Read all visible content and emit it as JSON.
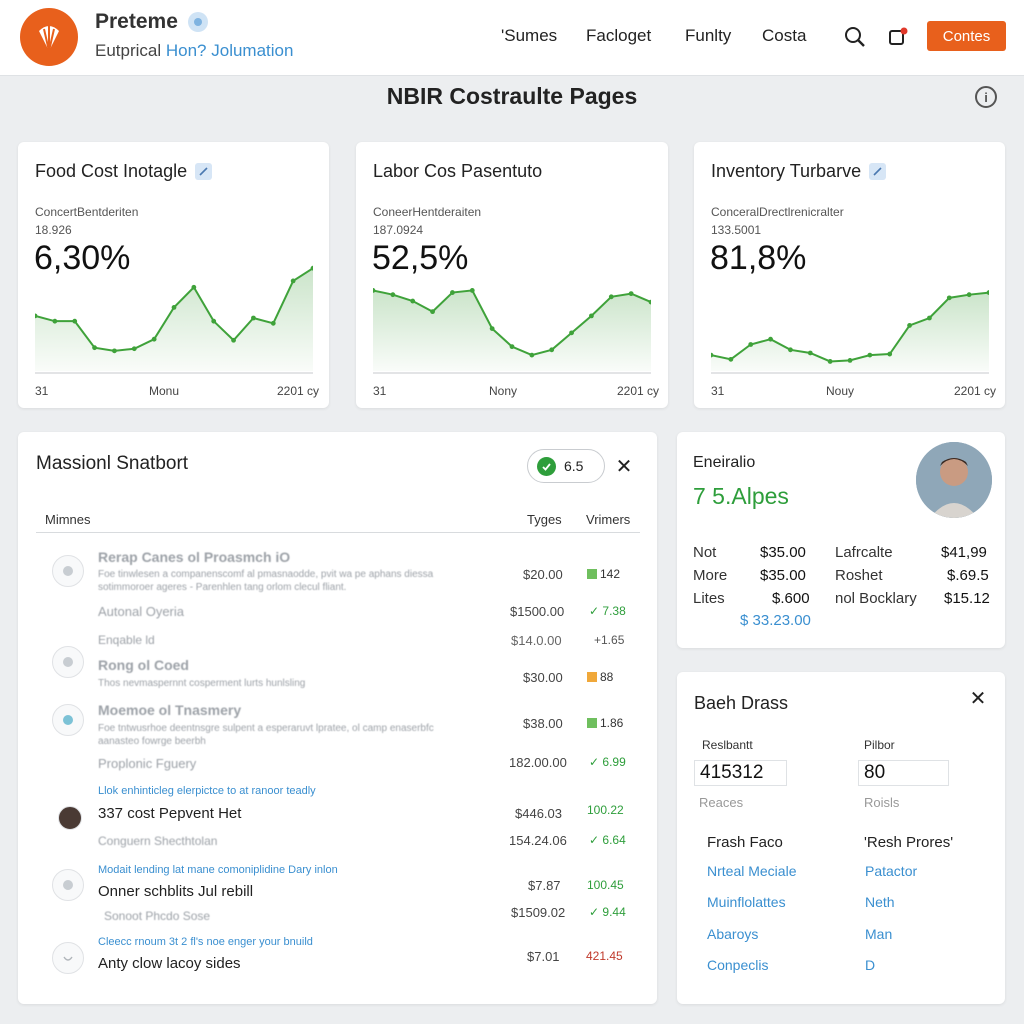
{
  "header": {
    "brand_name": "Preteme",
    "subtitle_plain": "Eutprical ",
    "subtitle_accent": "Hon? Jolumation",
    "nav": [
      "'Sumes",
      "Facloget",
      "Funlty",
      "Costa"
    ],
    "contact_label": "Contes",
    "icons": [
      "search-icon",
      "notification-icon"
    ]
  },
  "page": {
    "title": "NBIR Costraulte Pages",
    "info_icon": "i"
  },
  "kpis": [
    {
      "title": "Food  Cost Inotagle",
      "sub": "ConcertBentderiten",
      "sub2": "18.926",
      "value": "6,30%",
      "x_start": "31",
      "x_mid": "Monu",
      "x_end": "2201 cy",
      "has_edit": true,
      "trend": [
        0.52,
        0.47,
        0.47,
        0.22,
        0.19,
        0.21,
        0.3,
        0.6,
        0.79,
        0.47,
        0.29,
        0.5,
        0.45,
        0.85,
        0.97
      ]
    },
    {
      "title": "Labor Cos Pasentuto",
      "sub": "ConeerHentderaiten",
      "sub2": "187.0924",
      "value": "52,5%",
      "x_start": "31",
      "x_mid": "Nony",
      "x_end": "2201 cy",
      "has_edit": false,
      "trend": [
        0.76,
        0.72,
        0.66,
        0.56,
        0.74,
        0.76,
        0.4,
        0.23,
        0.15,
        0.2,
        0.36,
        0.52,
        0.7,
        0.73,
        0.65
      ]
    },
    {
      "title": "Inventory Turbarve",
      "sub": "ConceralDrectlrenicralter",
      "sub2": "133.5001",
      "value": "81,8%",
      "x_start": "31",
      "x_mid": "Nouy",
      "x_end": "2201 cy",
      "has_edit": true,
      "trend": [
        0.15,
        0.11,
        0.25,
        0.3,
        0.2,
        0.17,
        0.09,
        0.1,
        0.15,
        0.16,
        0.43,
        0.5,
        0.69,
        0.72,
        0.74
      ]
    }
  ],
  "seasonal": {
    "title": "Massionl Snatbort",
    "toggle_value": "6.5",
    "columns": [
      "Mimnes",
      "Tyges",
      "Vrimers"
    ],
    "rows": [
      {
        "name": "Rerap Canes ol Proasmch iO",
        "desc": "Foe tinwlesen a companenscomf al pmasnaodde, pvit wa pe aphans diessa",
        "desc2": "sotimmoroer ageres - Parenhlen tang orlom clecul fliant.",
        "price": "$20.00",
        "change": "142",
        "change_color": "green-box",
        "faded": true
      },
      {
        "name": "Autonal Oyeria",
        "price": "$1500.00",
        "change": "7.38",
        "change_color": "green-check",
        "faded": true
      },
      {
        "name": "Enqable ld",
        "price": "$14.0.00",
        "change": "+1.65",
        "change_color": "gray",
        "faded": true
      },
      {
        "name": "Rong ol Coed",
        "desc": "Thos nevmaspernnt cosperment lurts hunlsling",
        "price": "$30.00",
        "change": "88",
        "change_color": "orange-box",
        "faded": true
      },
      {
        "name": "Moemoe ol Tnasmery",
        "desc": "Foe tntwusrhoe deentnsgre sulpent a esperaruvt lpratee, ol camp enaserbfc",
        "desc2": "aanasteo fowrge beerbh",
        "price": "$38.00",
        "change": "1.86",
        "change_color": "green-box",
        "faded": true
      },
      {
        "name": "Proplonic Fguery",
        "price": "182.00.00",
        "change": "6.99",
        "change_color": "green-check",
        "faded": true
      },
      {
        "note": "Llok enhinticleg elerpictce to at ranoor teadly",
        "name": "337 cost Pepvent Het",
        "price": "$446.03",
        "change": "100.22",
        "change_color": "green",
        "faded": false
      },
      {
        "name": "Conguern Shecthtolan",
        "price": "154.24.06",
        "change": "6.64",
        "change_color": "green-check",
        "faded": true
      },
      {
        "note": "Modait lending lat mane comoniplidine Dary inlon",
        "name": "Onner schblits Jul rebill",
        "price": "$7.87",
        "change": "100.45",
        "change_color": "green",
        "faded": false
      },
      {
        "name": "Sonoot Phcdo Sose",
        "price": "$1509.02",
        "change": "9.44",
        "change_color": "green-check",
        "faded": true
      },
      {
        "note": "Cleecc rnoum 3t 2 fl's noe enger your bnuild",
        "name": "Anty clow lacoy sides",
        "price": "$7.01",
        "change": "421.45",
        "change_color": "red",
        "faded": false
      }
    ]
  },
  "gainfull": {
    "title": "Eneiralio",
    "headline": "7 5.Alpes",
    "left_rows": [
      {
        "label": "Not",
        "value": "$35.00"
      },
      {
        "label": "More",
        "value": "$35.00"
      },
      {
        "label": "Lites",
        "value": "$.600"
      }
    ],
    "right_rows": [
      {
        "label": "Lafrcalte",
        "value": "$41,99"
      },
      {
        "label": "Roshet",
        "value": "$.69.5"
      },
      {
        "label": "nol Bocklary",
        "value": "$15.12"
      }
    ],
    "total": "$ 33.23.00"
  },
  "batch": {
    "title": "Baeh Drass",
    "left": {
      "label": "Reslbantt",
      "value": "415312",
      "hint": "Reaces"
    },
    "right": {
      "label": "Pilbor",
      "value": "80",
      "hint": "Roisls"
    },
    "left_list_header": "Frash Faco",
    "right_list_header": "'Resh Prores'",
    "left_links": [
      "Nrteal Meciale",
      "Muinflolattes",
      "Abaroys",
      "Conpeclis"
    ],
    "right_links": [
      "Patactor",
      "Neth",
      "Man",
      "D"
    ]
  },
  "colors": {
    "accent": "#e8601c",
    "positive": "#2e9e3b",
    "link": "#3a8fd0",
    "negative": "#c0392b"
  }
}
